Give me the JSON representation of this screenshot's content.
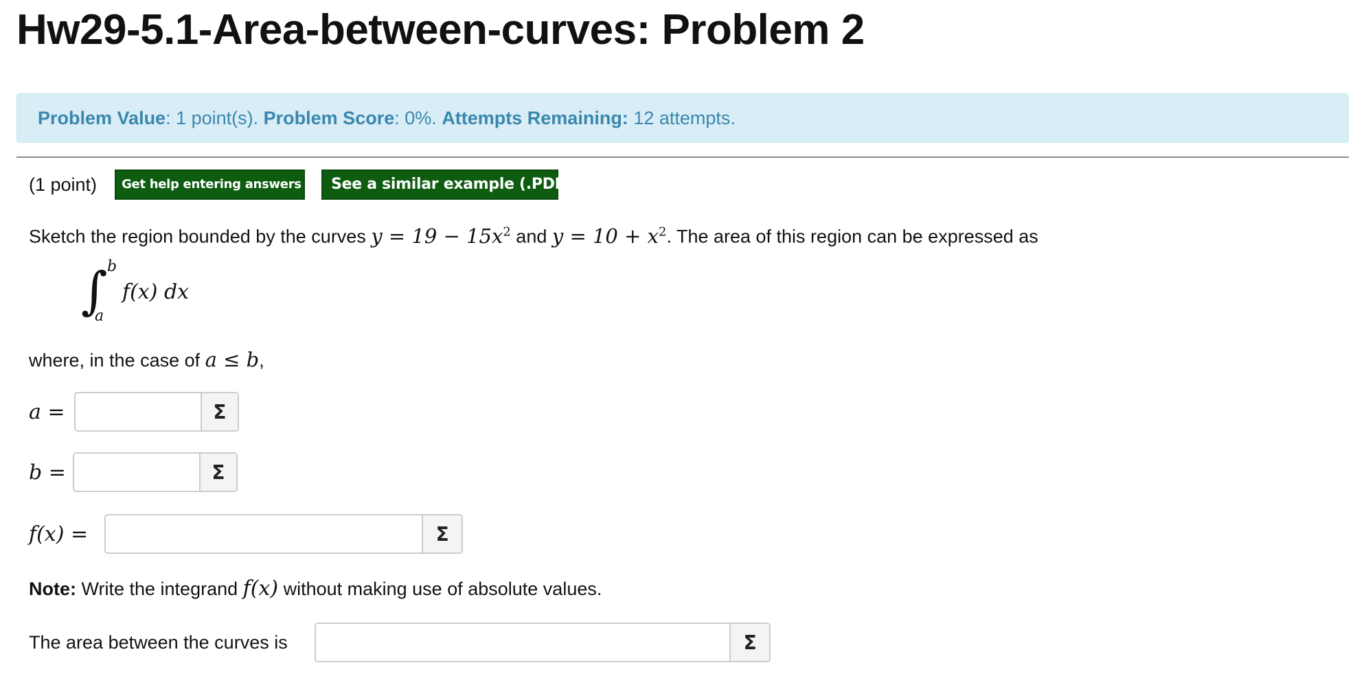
{
  "header": {
    "title": "Hw29-5.1-Area-between-curves: Problem 2"
  },
  "info": {
    "value_label": "Problem Value",
    "value_text": ": 1 point(s).",
    "score_label": "Problem Score",
    "score_text": ": 0%.",
    "attempts_label": "Attempts Remaining:",
    "attempts_text": "12 attempts."
  },
  "problem": {
    "points": "(1 point)",
    "help_button": "Get help entering answers",
    "example_button": "See a similar example (.PDF)",
    "statement_prefix": "Sketch the region bounded by the curves ",
    "curve1": "y = 19 − 15x",
    "curve1_exp": "2",
    "statement_and": " and ",
    "curve2": "y = 10 + x",
    "curve2_exp": "2",
    "statement_suffix": ". The area of this region can be expressed as",
    "integral": {
      "sign": "∫",
      "upper": "b",
      "lower": "a",
      "integrand": "f(x) dx"
    },
    "where_text": "where, in the case of ",
    "where_math": "a ≤ b",
    "where_comma": ",",
    "note_label": "Note:",
    "note_text_pre": " Write the integrand ",
    "note_math": "f(x)",
    "note_text_post": " without making use of absolute values."
  },
  "fields": {
    "a_label": "a =",
    "a_value": "",
    "b_label": "b =",
    "b_value": "",
    "f_label": "f(x) =",
    "f_value": "",
    "area_label": "The area between the curves is",
    "area_value": "",
    "sigma": "Σ"
  }
}
